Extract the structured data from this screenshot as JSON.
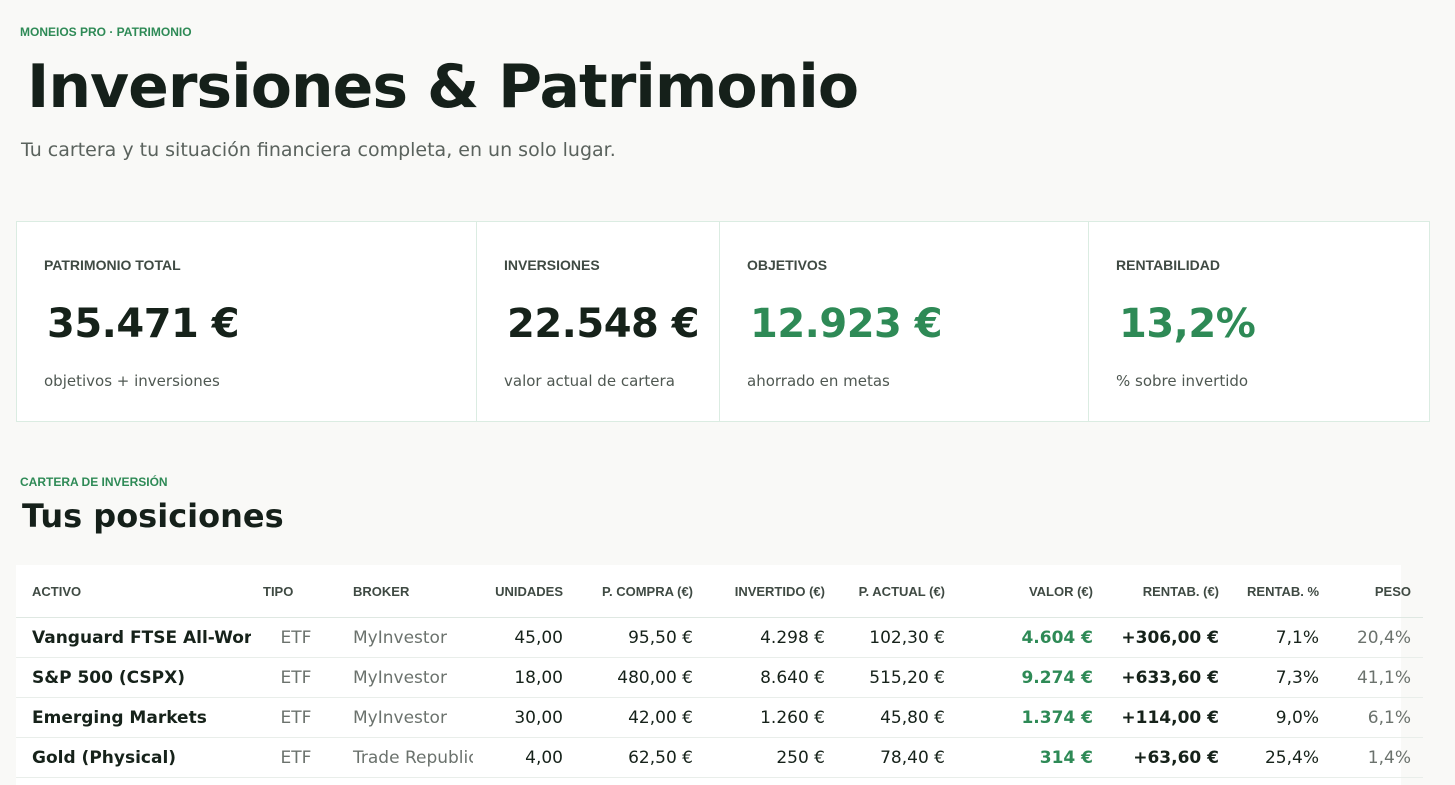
{
  "header": {
    "eyebrow": "MONEIOS PRO · PATRIMONIO",
    "title": "Inversiones & Patrimonio",
    "subtitle": "Tu cartera y tu situación financiera completa, en un solo lugar."
  },
  "summary_cards": [
    {
      "label": "PATRIMONIO TOTAL",
      "value": "35.471 €",
      "sub": "objetivos + inversiones",
      "accent": "dark"
    },
    {
      "label": "INVERSIONES",
      "value": "22.548 €",
      "sub": "valor actual de cartera",
      "accent": "dark"
    },
    {
      "label": "OBJETIVOS",
      "value": "12.923 €",
      "sub": "ahorrado en metas",
      "accent": "green"
    },
    {
      "label": "RENTABILIDAD",
      "value": "13,2%",
      "sub": "% sobre invertido",
      "accent": "green"
    }
  ],
  "portfolio": {
    "eyebrow": "CARTERA DE INVERSIÓN",
    "title": "Tus posiciones",
    "columns": [
      "ACTIVO",
      "TIPO",
      "BROKER",
      "UNIDADES",
      "P. COMPRA (€)",
      "INVERTIDO (€)",
      "P. ACTUAL (€)",
      "VALOR (€)",
      "RENTAB. (€)",
      "RENTAB. %",
      "PESO"
    ],
    "rows": [
      [
        "Vanguard FTSE All-World",
        "ETF",
        "MyInvestor",
        "45,00",
        "95,50 €",
        "4.298 €",
        "102,30 €",
        "4.604 €",
        "+306,00 €",
        "7,1%",
        "20,4%"
      ],
      [
        "S&P 500 (CSPX)",
        "ETF",
        "MyInvestor",
        "18,00",
        "480,00 €",
        "8.640 €",
        "515,20 €",
        "9.274 €",
        "+633,60 €",
        "7,3%",
        "41,1%"
      ],
      [
        "Emerging Markets",
        "ETF",
        "MyInvestor",
        "30,00",
        "42,00 €",
        "1.260 €",
        "45,80 €",
        "1.374 €",
        "+114,00 €",
        "9,0%",
        "6,1%"
      ],
      [
        "Gold (Physical)",
        "ETF",
        "Trade Republic",
        "4,00",
        "62,50 €",
        "250 €",
        "78,40 €",
        "314 €",
        "+63,60 €",
        "25,4%",
        "1,4%"
      ]
    ]
  },
  "colors": {
    "accent_green": "#2e8a56",
    "text_dark": "#16221a",
    "background": "#f9f9f7",
    "border": "#dbece2"
  }
}
